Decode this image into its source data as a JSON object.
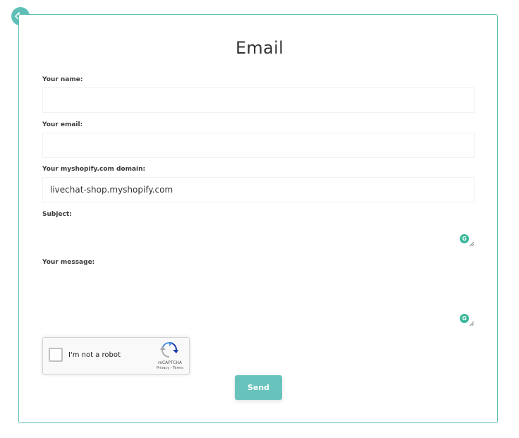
{
  "colors": {
    "accent": "#5fbfb7",
    "button": "#68c3bc",
    "grammarly": "#3ab89a"
  },
  "header": {
    "back_icon": "arrow-left-icon"
  },
  "form": {
    "title": "Email",
    "name": {
      "label": "Your name:",
      "value": ""
    },
    "email": {
      "label": "Your email:",
      "value": ""
    },
    "domain": {
      "label": "Your myshopify.com domain:",
      "value": "livechat-shop.myshopify.com"
    },
    "subject": {
      "label": "Subject:",
      "value": ""
    },
    "message": {
      "label": "Your message:",
      "value": ""
    },
    "send_label": "Send"
  },
  "recaptcha": {
    "label": "I'm not a robot",
    "brand": "reCAPTCHA",
    "links": "Privacy - Terms",
    "checked": false
  },
  "grammarly": {
    "letter": "G",
    "icon": "grammarly-icon"
  }
}
